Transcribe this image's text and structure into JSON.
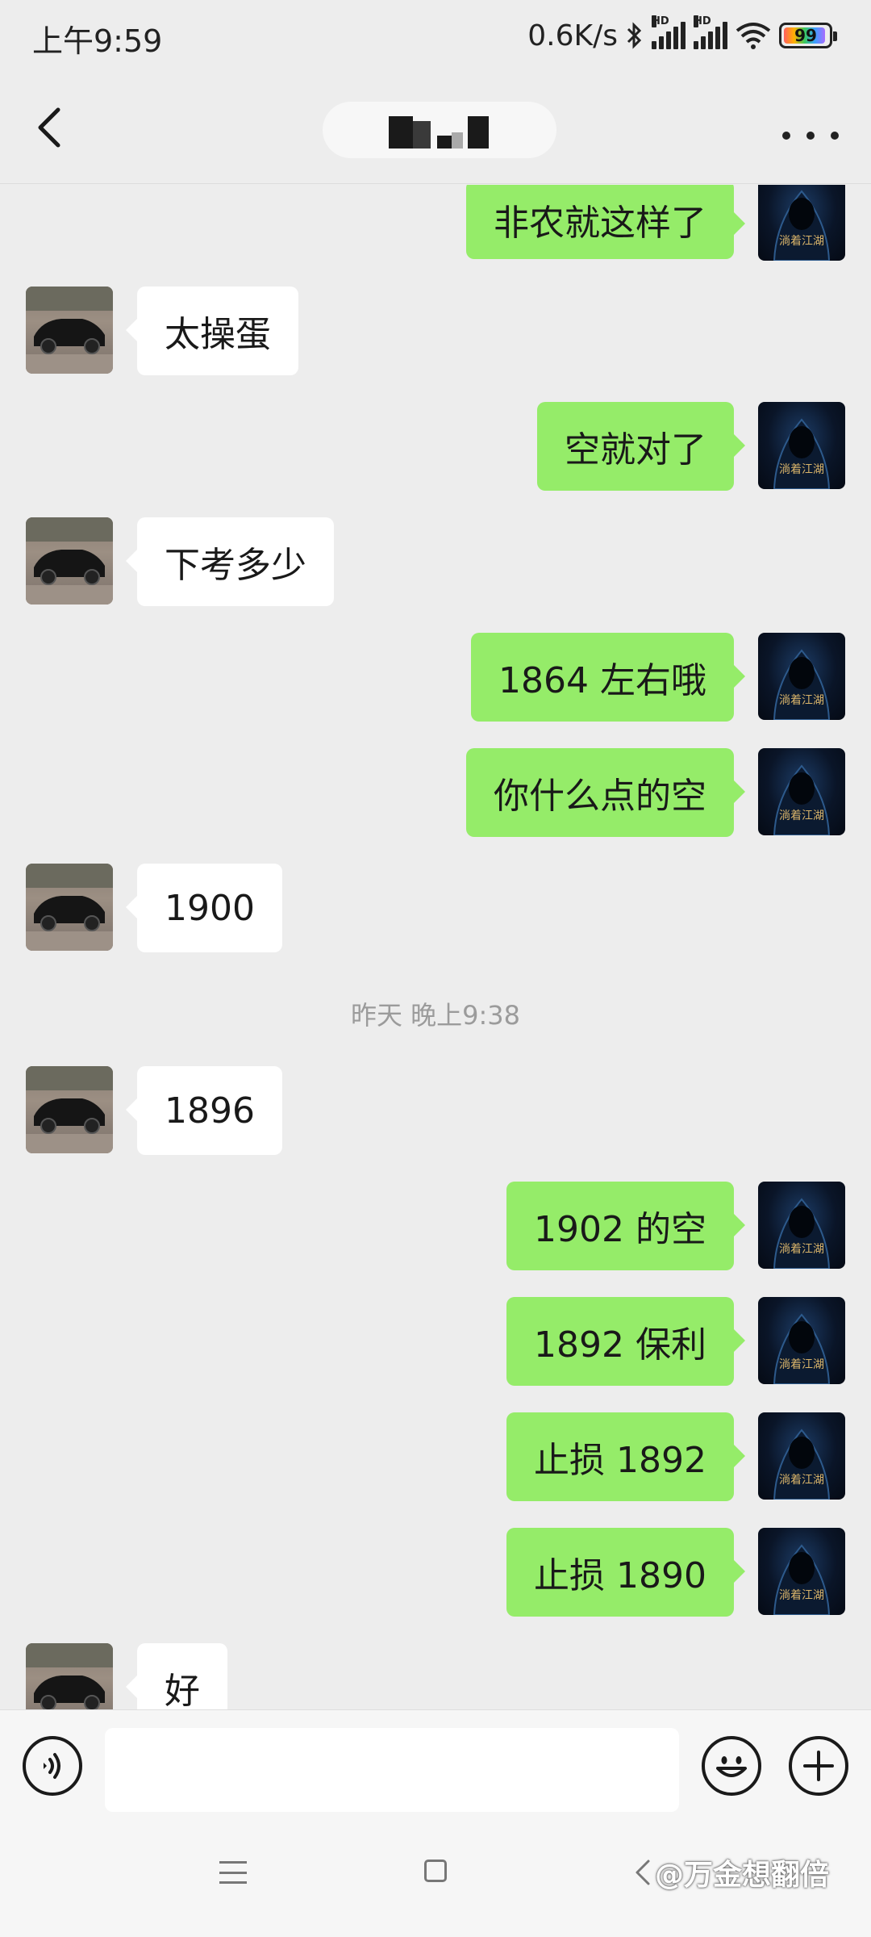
{
  "status_bar": {
    "time": "上午9:59",
    "net_speed": "0.6K/s",
    "signal_label": "HD",
    "battery_level": "99",
    "icons": [
      "bluetooth-icon",
      "signal-icon",
      "signal-icon",
      "wifi-icon",
      "battery-icon"
    ]
  },
  "header": {
    "back_icon": "chevron-left-icon",
    "more_icon": "more-dots-icon"
  },
  "messages": [
    {
      "side": "me",
      "text": "非农就这样了"
    },
    {
      "side": "other",
      "text": "太操蛋"
    },
    {
      "side": "me",
      "text": "空就对了"
    },
    {
      "side": "other",
      "text": "下考多少"
    },
    {
      "side": "me",
      "text": "1864 左右哦"
    },
    {
      "side": "me",
      "text": "你什么点的空"
    },
    {
      "side": "other",
      "text": "1900"
    },
    {
      "side": "other",
      "text": "1896"
    },
    {
      "side": "me",
      "text": "1902 的空"
    },
    {
      "side": "me",
      "text": "1892 保利"
    },
    {
      "side": "me",
      "text": "止损 1892"
    },
    {
      "side": "me",
      "text": "止损 1890"
    },
    {
      "side": "other",
      "text": "好"
    }
  ],
  "timestamp": "昨天 晚上9:38",
  "avatar_me_text": "淌着江湖",
  "input_bar": {
    "value": "",
    "placeholder": "",
    "icons": [
      "voice-icon",
      "emoji-icon",
      "plus-icon"
    ]
  },
  "system_nav": {
    "icons": [
      "menu-icon",
      "home-icon",
      "back-icon"
    ],
    "watermark": "@万金想翻倍"
  },
  "colors": {
    "background": "#ededed",
    "bubble_me": "#95ec69",
    "bubble_other": "#ffffff"
  }
}
